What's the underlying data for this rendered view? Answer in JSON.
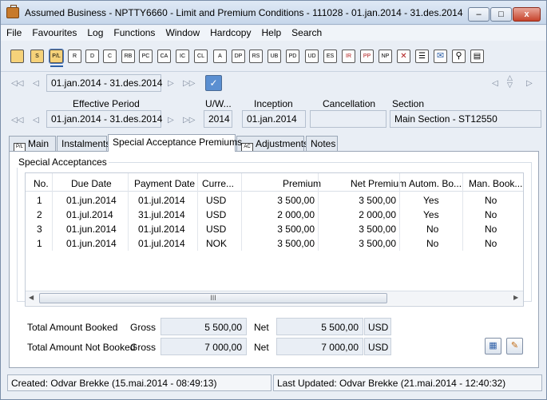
{
  "window": {
    "title": "Assumed Business - NPTTY6660 - Limit and Premium Conditions - 111028 - 01.jan.2014 - 31.des.2014",
    "min_label": "–",
    "max_label": "□",
    "close_label": "x"
  },
  "menu": [
    "File",
    "Favourites",
    "Log",
    "Functions",
    "Window",
    "Hardcopy",
    "Help",
    "Search"
  ],
  "toolbar": {
    "buttons": [
      "S",
      "P/L",
      "R",
      "D",
      "C",
      "RB",
      "PC",
      "CA",
      "IC",
      "CL",
      "A",
      "DP",
      "RS",
      "UB",
      "PD",
      "UD",
      "ES",
      "IR",
      "PP",
      "NP"
    ],
    "icons": [
      "briefcase-icon",
      "delete-doc-icon",
      "checklist-icon",
      "mail-icon",
      "attach-icon",
      "printer-icon"
    ]
  },
  "period_nav": {
    "period": "01.jan.2014 - 31.des.2014"
  },
  "header": {
    "labels": {
      "effective_period": "Effective Period",
      "uw": "U/W...",
      "inception": "Inception",
      "cancellation": "Cancellation",
      "section": "Section"
    },
    "values": {
      "effective_period": "01.jan.2014 - 31.des.2014",
      "uw": "2014",
      "inception": "01.jan.2014",
      "cancellation": "",
      "section": "Main Section - ST12550"
    }
  },
  "tabs": [
    {
      "label": "Main",
      "icon": "P/L"
    },
    {
      "label": "Instalments",
      "icon": ""
    },
    {
      "label": "Special Acceptance Premiums",
      "icon": ""
    },
    {
      "label": "Adjustments",
      "icon": "AC"
    },
    {
      "label": "Notes",
      "icon": ""
    }
  ],
  "group_title": "Special Acceptances",
  "table": {
    "columns": [
      "No.",
      "Due Date",
      "Payment Date",
      "Curre...",
      "Premium",
      "Net Premium",
      "Autom. Bo...",
      "Man. Book..."
    ],
    "rows": [
      [
        "1",
        "01.jun.2014",
        "01.jul.2014",
        "USD",
        "3 500,00",
        "3 500,00",
        "Yes",
        "No"
      ],
      [
        "2",
        "01.jul.2014",
        "31.jul.2014",
        "USD",
        "2 000,00",
        "2 000,00",
        "Yes",
        "No"
      ],
      [
        "3",
        "01.jun.2014",
        "01.jul.2014",
        "USD",
        "3 500,00",
        "3 500,00",
        "No",
        "No"
      ],
      [
        "1",
        "01.jun.2014",
        "01.jul.2014",
        "NOK",
        "3 500,00",
        "3 500,00",
        "No",
        "No"
      ]
    ],
    "scroll_thumb": "III"
  },
  "totals": {
    "booked": {
      "label": "Total Amount Booked",
      "gross_label": "Gross",
      "gross": "5 500,00",
      "net_label": "Net",
      "net": "5 500,00",
      "currency": "USD"
    },
    "not_booked": {
      "label": "Total Amount Not Booked",
      "gross_label": "Gross",
      "gross": "7 000,00",
      "net_label": "Net",
      "net": "7 000,00",
      "currency": "USD"
    }
  },
  "status": {
    "created": "Created: Odvar Brekke (15.mai.2014 - 08:49:13)",
    "updated": "Last Updated: Odvar Brekke (21.mai.2014 - 12:40:32)"
  }
}
